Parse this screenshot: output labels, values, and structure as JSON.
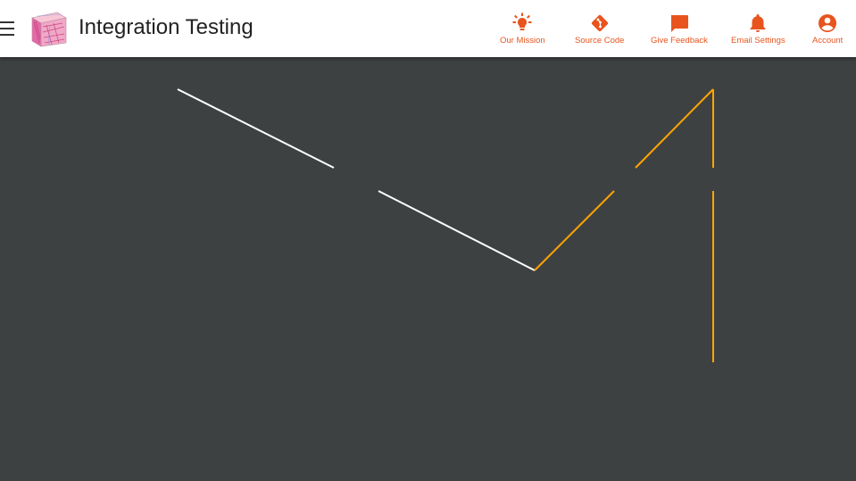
{
  "header": {
    "title": "Integration Testing",
    "accent_color": "#e8541e",
    "menu_icon": "hamburger-menu-icon",
    "logo": "cube-logo"
  },
  "nav": [
    {
      "label": "Our Mission",
      "icon": "lightbulb-icon"
    },
    {
      "label": "Source Code",
      "icon": "git-icon"
    },
    {
      "label": "Give Feedback",
      "icon": "chat-bubble-icon"
    },
    {
      "label": "Email Settings",
      "icon": "bell-icon"
    },
    {
      "label": "Account",
      "icon": "account-circle-icon"
    }
  ],
  "canvas": {
    "background": "#3e4142",
    "line_colors": [
      "#ffffff",
      "#ffa500"
    ]
  }
}
